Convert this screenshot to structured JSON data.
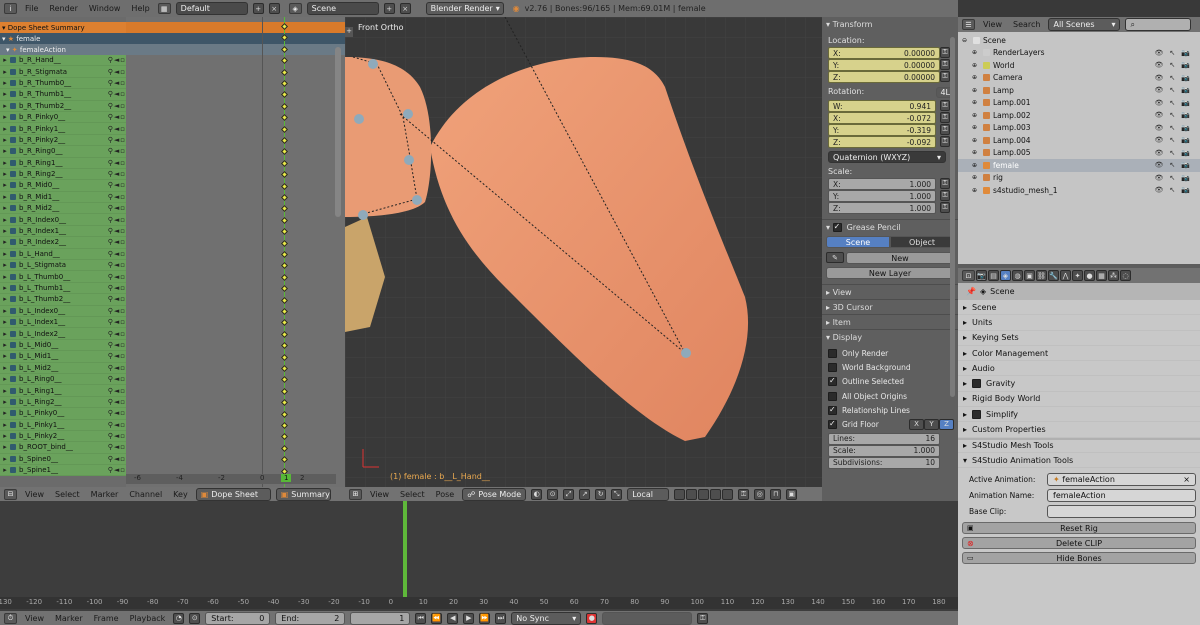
{
  "topbar": {
    "menus": [
      "File",
      "Render",
      "Window",
      "Help"
    ],
    "layout": "Default",
    "scene": "Scene",
    "engine": "Blender Render",
    "info": "v2.76 | Bones:96/165 | Mem:69.01M | female"
  },
  "dopesheet": {
    "summary": "Dope Sheet Summary",
    "object": "female",
    "action": "femaleAction",
    "channels": [
      "b_R_Hand__",
      "b_R_Stigmata",
      "b_R_Thumb0__",
      "b_R_Thumb1__",
      "b_R_Thumb2__",
      "b_R_Pinky0__",
      "b_R_Pinky1__",
      "b_R_Pinky2__",
      "b_R_Ring0__",
      "b_R_Ring1__",
      "b_R_Ring2__",
      "b_R_Mid0__",
      "b_R_Mid1__",
      "b_R_Mid2__",
      "b_R_Index0__",
      "b_R_Index1__",
      "b_R_Index2__",
      "b_L_Hand__",
      "b_L_Stigmata",
      "b_L_Thumb0__",
      "b_L_Thumb1__",
      "b_L_Thumb2__",
      "b_L_Index0__",
      "b_L_Index1__",
      "b_L_Index2__",
      "b_L_Mid0__",
      "b_L_Mid1__",
      "b_L_Mid2__",
      "b_L_Ring0__",
      "b_L_Ring1__",
      "b_L_Ring2__",
      "b_L_Pinky0__",
      "b_L_Pinky1__",
      "b_L_Pinky2__",
      "b_ROOT_bind__",
      "b_Spine0__",
      "b_Spine1__"
    ],
    "ruler": [
      "-6",
      "-4",
      "-2",
      "0",
      "2"
    ],
    "current_frame": "1",
    "header": {
      "menus": [
        "View",
        "Select",
        "Marker",
        "Channel",
        "Key"
      ],
      "mode": "Dope Sheet",
      "summary_btn": "Summary"
    }
  },
  "viewport": {
    "label": "Front Ortho",
    "status": "(1) female : b__L_Hand__",
    "header": {
      "menus": [
        "View",
        "Select",
        "Pose"
      ],
      "mode": "Pose Mode",
      "orientation": "Local"
    }
  },
  "npanel": {
    "transform_title": "Transform",
    "location_label": "Location:",
    "location": [
      {
        "k": "X:",
        "v": "0.00000"
      },
      {
        "k": "Y:",
        "v": "0.00000"
      },
      {
        "k": "Z:",
        "v": "0.00000"
      }
    ],
    "rotation_label": "Rotation:",
    "rot_mode_badge": "4L",
    "rotation": [
      {
        "k": "W:",
        "v": "0.941"
      },
      {
        "k": "X:",
        "v": "-0.072"
      },
      {
        "k": "Y:",
        "v": "-0.319"
      },
      {
        "k": "Z:",
        "v": "-0.092"
      }
    ],
    "rot_mode": "Quaternion (WXYZ)",
    "scale_label": "Scale:",
    "scale": [
      {
        "k": "X:",
        "v": "1.000"
      },
      {
        "k": "Y:",
        "v": "1.000"
      },
      {
        "k": "Z:",
        "v": "1.000"
      }
    ],
    "grease_title": "Grease Pencil",
    "gp_tabs": [
      "Scene",
      "Object"
    ],
    "gp_new": "New",
    "gp_new_layer": "New Layer",
    "sections": [
      "View",
      "3D Cursor",
      "Item",
      "Display"
    ],
    "display_opts": [
      {
        "label": "Only Render",
        "on": false
      },
      {
        "label": "World Background",
        "on": false
      },
      {
        "label": "Outline Selected",
        "on": true
      },
      {
        "label": "All Object Origins",
        "on": false
      },
      {
        "label": "Relationship Lines",
        "on": true
      }
    ],
    "grid_floor": "Grid Floor",
    "axes": [
      "X",
      "Y",
      "Z"
    ],
    "grid": [
      {
        "k": "Lines:",
        "v": "16"
      },
      {
        "k": "Scale:",
        "v": "1.000"
      },
      {
        "k": "Subdivisions:",
        "v": "10"
      }
    ]
  },
  "outliner": {
    "menus": [
      "View",
      "Search"
    ],
    "filter": "All Scenes",
    "rows": [
      {
        "name": "Scene",
        "depth": 0,
        "color": "#e0e0e0"
      },
      {
        "name": "RenderLayers",
        "depth": 1,
        "color": "#ccc"
      },
      {
        "name": "World",
        "depth": 1,
        "color": "#cc5"
      },
      {
        "name": "Camera",
        "depth": 1,
        "color": "#d08040"
      },
      {
        "name": "Lamp",
        "depth": 1,
        "color": "#d08040"
      },
      {
        "name": "Lamp.001",
        "depth": 1,
        "color": "#d08040"
      },
      {
        "name": "Lamp.002",
        "depth": 1,
        "color": "#d08040"
      },
      {
        "name": "Lamp.003",
        "depth": 1,
        "color": "#d08040"
      },
      {
        "name": "Lamp.004",
        "depth": 1,
        "color": "#d08040"
      },
      {
        "name": "Lamp.005",
        "depth": 1,
        "color": "#d08040"
      },
      {
        "name": "female",
        "depth": 1,
        "color": "#e08a3a"
      },
      {
        "name": "rig",
        "depth": 1,
        "color": "#d08040"
      },
      {
        "name": "s4studio_mesh_1",
        "depth": 1,
        "color": "#e08a3a"
      }
    ]
  },
  "properties": {
    "breadcrumb": "Scene",
    "sections": [
      "Scene",
      "Units",
      "Keying Sets",
      "Color Management",
      "Audio",
      "Gravity",
      "Rigid Body World",
      "Simplify",
      "Custom Properties",
      "S4Studio Mesh Tools",
      "S4Studio Animation Tools"
    ],
    "active_anim_label": "Active Animation:",
    "active_anim": "femaleAction",
    "anim_name_label": "Animation Name:",
    "anim_name": "femaleAction",
    "base_clip_label": "Base Clip:",
    "base_clip": "",
    "reset_rig": "Reset Rig",
    "delete_clip": "Delete CLIP",
    "hide_bones": "Hide Bones"
  },
  "timeline": {
    "ticks": [
      "-130",
      "-120",
      "-110",
      "-100",
      "-90",
      "-80",
      "-70",
      "-60",
      "-50",
      "-40",
      "-30",
      "-20",
      "-10",
      "0",
      "10",
      "20",
      "30",
      "40",
      "50",
      "60",
      "70",
      "80",
      "90",
      "100",
      "110",
      "120",
      "130",
      "140",
      "150",
      "160",
      "170",
      "180"
    ],
    "header": {
      "menus": [
        "View",
        "Marker",
        "Frame",
        "Playback"
      ],
      "start": "Start:",
      "start_v": "0",
      "end": "End:",
      "end_v": "2",
      "cur": "1",
      "sync": "No Sync"
    }
  }
}
